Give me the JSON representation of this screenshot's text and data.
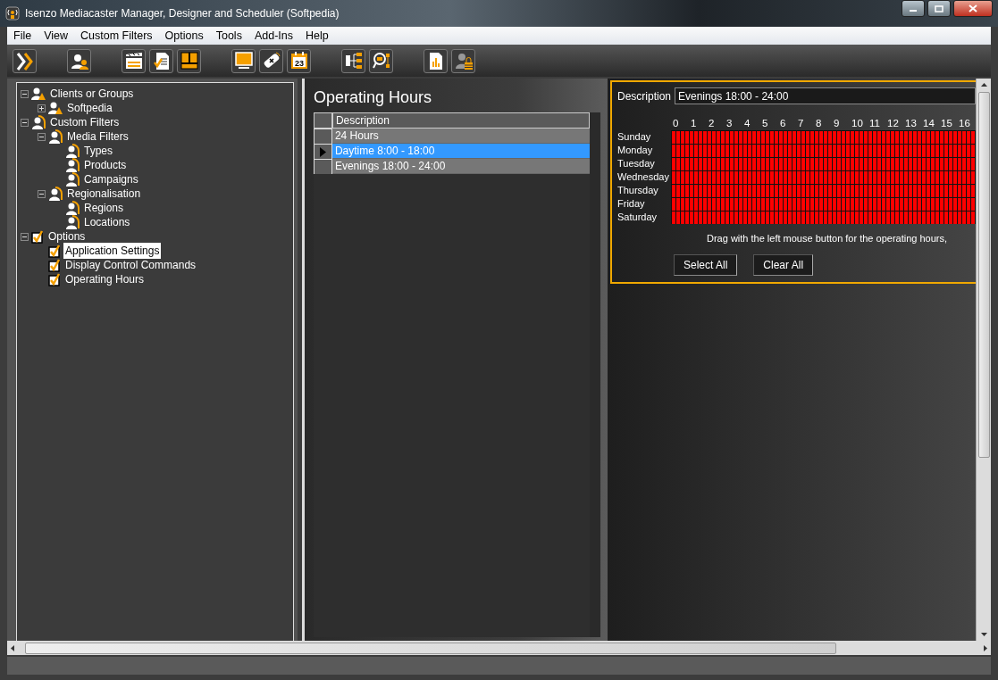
{
  "window": {
    "title": "Isenzo Mediacaster Manager, Designer and Scheduler (Softpedia)"
  },
  "menu": [
    "File",
    "View",
    "Custom Filters",
    "Options",
    "Tools",
    "Add-Ins",
    "Help"
  ],
  "toolbar": [
    {
      "kind": "forward"
    },
    {
      "kind": "users"
    },
    {
      "kind": "clapper"
    },
    {
      "kind": "doccheck"
    },
    {
      "kind": "layout"
    },
    {
      "kind": "monitor"
    },
    {
      "kind": "remote"
    },
    {
      "kind": "calendar",
      "label": "23"
    },
    {
      "kind": "tree"
    },
    {
      "kind": "inspect"
    },
    {
      "kind": "chart"
    },
    {
      "kind": "userlock"
    }
  ],
  "tree": [
    {
      "label": "Clients or Groups",
      "kind": "group",
      "expanded": true,
      "selected": false,
      "children": [
        {
          "label": "Softpedia",
          "kind": "group",
          "expanded": false,
          "selected": false
        }
      ]
    },
    {
      "label": "Custom Filters",
      "kind": "filter",
      "expanded": true,
      "selected": false,
      "children": [
        {
          "label": "Media Filters",
          "kind": "filter",
          "expanded": true,
          "selected": false,
          "children": [
            {
              "label": "Types",
              "kind": "filter",
              "selected": false
            },
            {
              "label": "Products",
              "kind": "filter",
              "selected": false
            },
            {
              "label": "Campaigns",
              "kind": "filter",
              "selected": false
            }
          ]
        },
        {
          "label": "Regionalisation",
          "kind": "filter",
          "expanded": true,
          "selected": false,
          "children": [
            {
              "label": "Regions",
              "kind": "filter",
              "selected": false
            },
            {
              "label": "Locations",
              "kind": "filter",
              "selected": false
            }
          ]
        }
      ]
    },
    {
      "label": "Options",
      "kind": "check",
      "checked": true,
      "expanded": true,
      "selected": false,
      "children": [
        {
          "label": "Application Settings",
          "kind": "check",
          "checked": true,
          "selected": true
        },
        {
          "label": "Display Control Commands",
          "kind": "check",
          "checked": true,
          "selected": false
        },
        {
          "label": "Operating Hours",
          "kind": "check",
          "checked": true,
          "selected": false
        }
      ]
    }
  ],
  "list_panel": {
    "title": "Operating Hours",
    "column": "Description",
    "rows": [
      {
        "text": "24 Hours",
        "selected": false
      },
      {
        "text": "Daytime 8:00 - 18:00",
        "selected": true
      },
      {
        "text": "Evenings 18:00 - 24:00",
        "selected": false
      }
    ]
  },
  "editor": {
    "description_label": "Description",
    "description_value": "Evenings 18:00 - 24:00",
    "hours": [
      "0",
      "1",
      "2",
      "3",
      "4",
      "5",
      "6",
      "7",
      "8",
      "9",
      "10",
      "11",
      "12",
      "13",
      "14",
      "15",
      "16"
    ],
    "days": [
      {
        "label": "Sunday",
        "on": true
      },
      {
        "label": "Monday",
        "on": true
      },
      {
        "label": "Tuesday",
        "on": true
      },
      {
        "label": "Wednesday",
        "on": true
      },
      {
        "label": "Thursday",
        "on": true
      },
      {
        "label": "Friday",
        "on": true
      },
      {
        "label": "Saturday",
        "on": true
      }
    ],
    "hint": "Drag with the left mouse button for the operating hours,",
    "buttons": [
      "Select All",
      "Clear All"
    ]
  }
}
